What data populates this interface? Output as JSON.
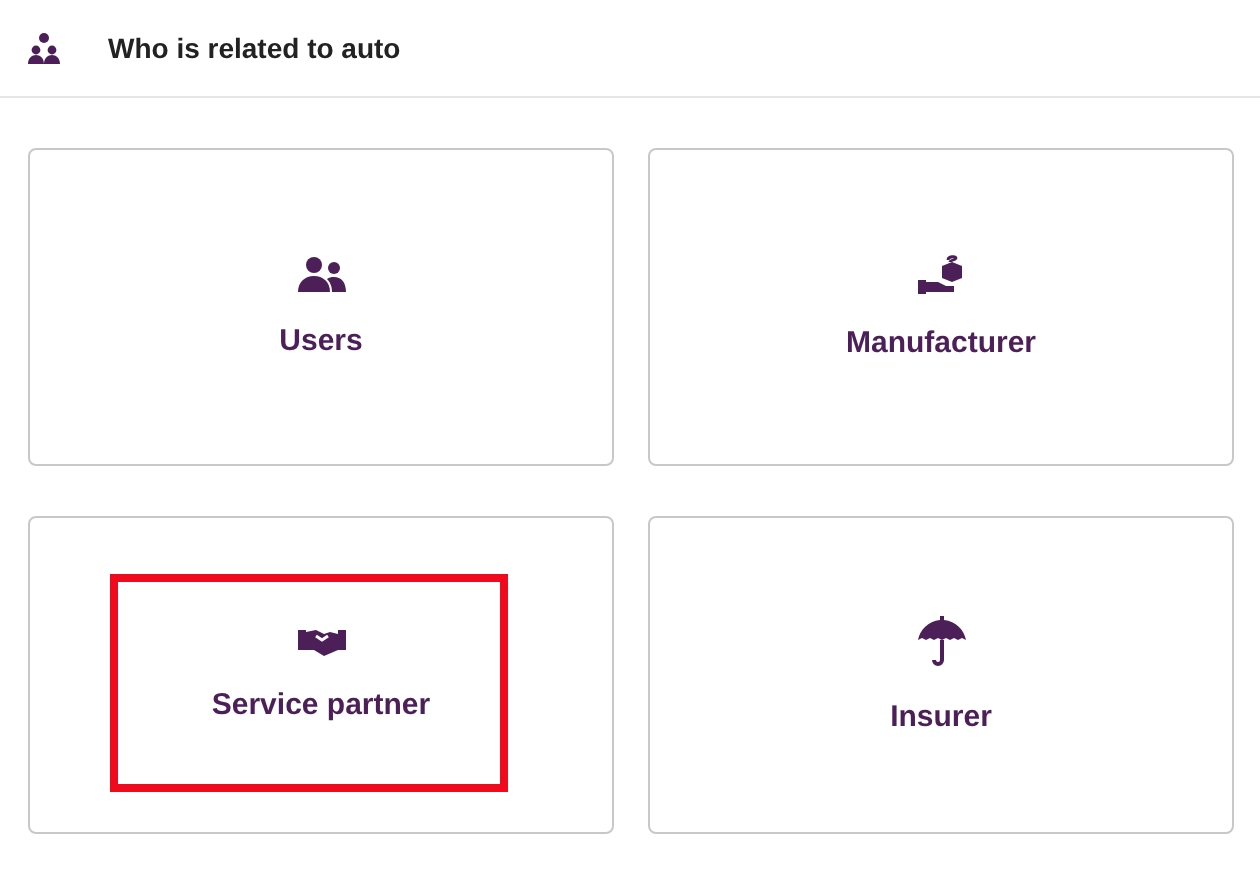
{
  "header": {
    "title": "Who is related to auto"
  },
  "cards": [
    {
      "label": "Users",
      "highlighted": false
    },
    {
      "label": "Manufacturer",
      "highlighted": false
    },
    {
      "label": "Service partner",
      "highlighted": true
    },
    {
      "label": "Insurer",
      "highlighted": false
    }
  ]
}
